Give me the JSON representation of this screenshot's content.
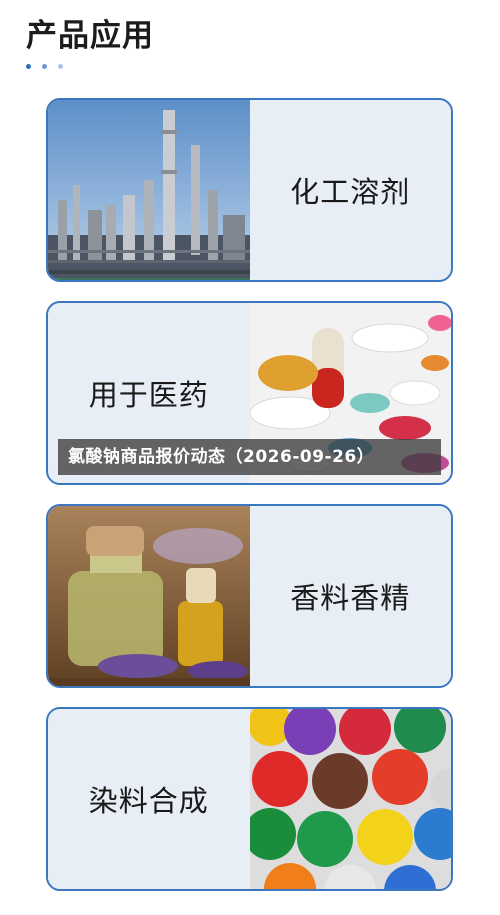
{
  "section": {
    "title": "产品应用"
  },
  "applications": [
    {
      "label": "化工溶剂",
      "image": "chemical-plant"
    },
    {
      "label": "用于医药",
      "image": "medicine-pills"
    },
    {
      "label": "香料香精",
      "image": "essential-oil-bottles"
    },
    {
      "label": "染料合成",
      "image": "paint-jars"
    }
  ],
  "overlay": {
    "text": "氯酸钠商品报价动态（2026-09-26）"
  },
  "colors": {
    "accent": "#3b76c0",
    "card_bg": "#e8eef6",
    "dot_1": "#2f6db8",
    "dot_2": "#6c9bd0",
    "dot_3": "#a9c6e6"
  }
}
